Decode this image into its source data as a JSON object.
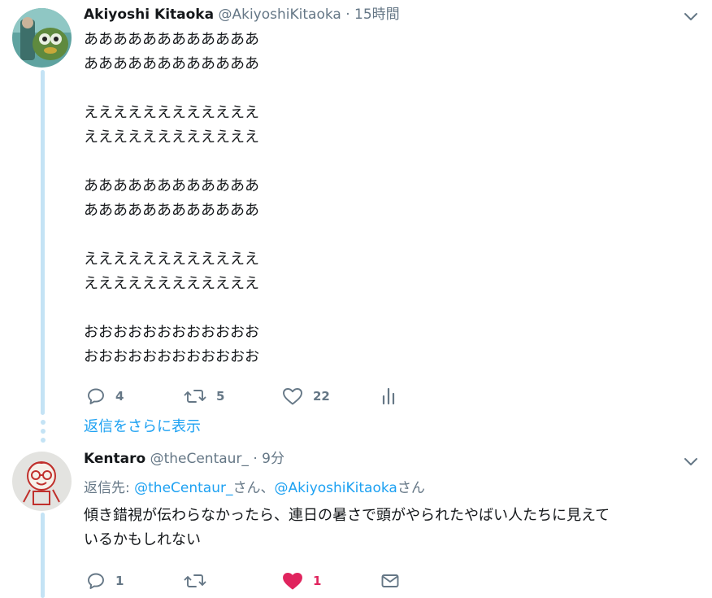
{
  "tweet1": {
    "name": "Akiyoshi Kitaoka",
    "handle": "@AkiyoshiKitaoka",
    "separator": "·",
    "time": "15時間",
    "lines": [
      "ああああああああああああ",
      "ああああああああああああ",
      "",
      "ええええええええええええ",
      "ええええええええええええ",
      "",
      "ああああああああああああ",
      "ああああああああああああ",
      "",
      "ええええええええええええ",
      "ええええええええええええ",
      "",
      "おおおおおおおおおおおお",
      "おおおおおおおおおおおお"
    ],
    "reply_count": "4",
    "retweet_count": "5",
    "like_count": "22"
  },
  "show_more_replies": "返信をさらに表示",
  "tweet2": {
    "name": "Kentaro",
    "handle": "@theCentaur_",
    "separator": "·",
    "time": "9分",
    "reply_prefix": "返信先: ",
    "reply_user1": "@theCentaur_",
    "reply_mid": "さん、",
    "reply_user2": "@AkiyoshiKitaoka",
    "reply_suffix": "さん",
    "lines": [
      "傾き錯視が伝わらなかったら、連日の暑さで頭がやられたやばい人たちに見えて",
      "いるかもしれない"
    ],
    "reply_count": "1",
    "like_count": "1",
    "liked": true
  },
  "colors": {
    "accent": "#1da1f2",
    "muted": "#657786",
    "like": "#e0245e",
    "thread_line": "#c4e3f5"
  },
  "icons": [
    "chevron-down-icon",
    "reply-icon",
    "retweet-icon",
    "like-icon",
    "analytics-icon",
    "direct-message-icon"
  ]
}
